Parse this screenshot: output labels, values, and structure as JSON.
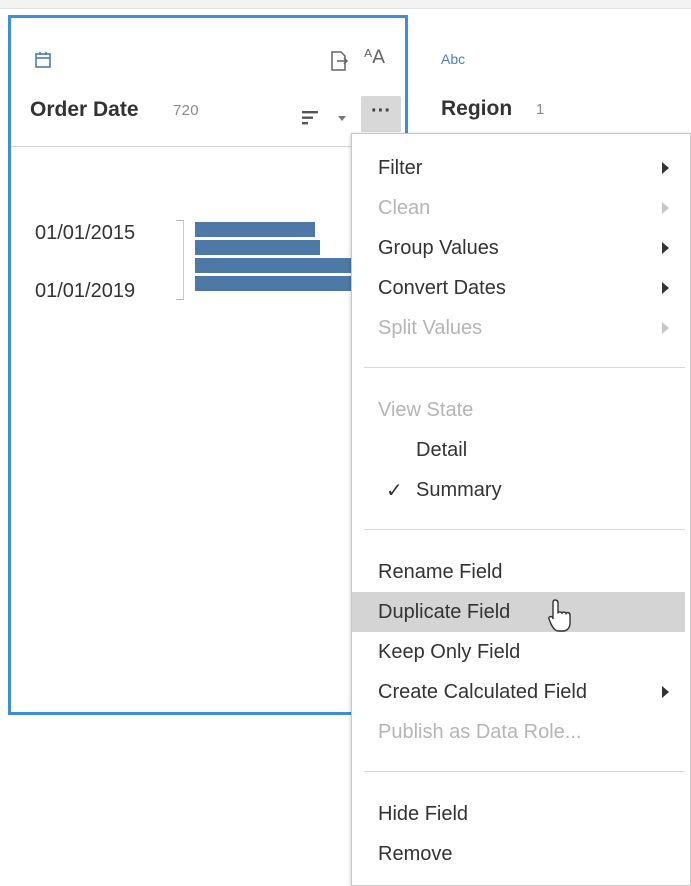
{
  "field_card": {
    "type_icon": "calendar-icon",
    "name": "Order Date",
    "count": "720",
    "tick_labels": [
      "01/01/2015",
      "01/01/2019"
    ],
    "histogram_values": [
      120,
      125,
      160,
      160
    ],
    "bar_color": "#4e79a7",
    "border_color": "#3d8fd6"
  },
  "region_card": {
    "type_label": "Abc",
    "name": "Region",
    "count": "1"
  },
  "menu": {
    "filter": "Filter",
    "clean": "Clean",
    "group_values": "Group Values",
    "convert_dates": "Convert Dates",
    "split_values": "Split Values",
    "view_state": "View State",
    "detail": "Detail",
    "summary": "Summary",
    "summary_check": "✓",
    "rename_field": "Rename Field",
    "duplicate_field": "Duplicate Field",
    "keep_only_field": "Keep Only Field",
    "create_calculated_field": "Create Calculated Field",
    "publish_as_data_role": "Publish as Data Role...",
    "hide_field": "Hide Field",
    "remove": "Remove",
    "hovered_item": "Duplicate Field"
  }
}
